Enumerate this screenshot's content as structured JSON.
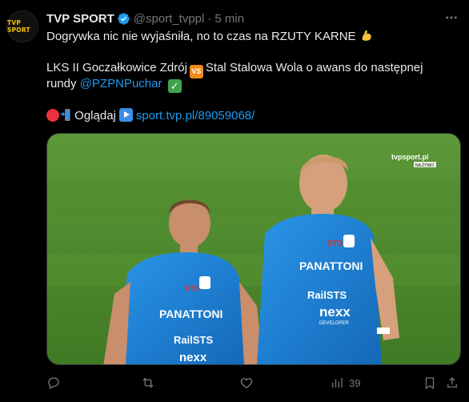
{
  "tweet": {
    "avatar_text": "TVP SPORT",
    "name": "TVP SPORT",
    "handle": "@sport_tvppl",
    "separator": "·",
    "time": "5 min",
    "line1": "Dogrywka nic nie wyjaśniła, no to czas na RZUTY KARNE",
    "line2_a": "LKS II Goczałkowice Zdrój",
    "line2_vs": "VS",
    "line2_b": "Stal Stalowa Wola o awans do następnej",
    "line3_a": "rundy",
    "line3_mention": "@PZPNPuchar",
    "line4_a": "Oglądaj",
    "line4_link": "sport.tvp.pl/89059068/"
  },
  "media": {
    "watermark": "tvpsport.pl",
    "live_badge": "NA ŻYWO",
    "shirt_sponsor": "PANATTONI",
    "shirt_rail": "RailSTS",
    "shirt_nexx": "nexx",
    "shirt_dev": "DEVELOPER",
    "shirt_sts": "STS"
  },
  "actions": {
    "views_count": "39"
  },
  "colors": {
    "accent": "#1d9bf0",
    "muted": "#71767b",
    "shirt": "#1f86d8",
    "pitch": "#4e8a2f"
  }
}
